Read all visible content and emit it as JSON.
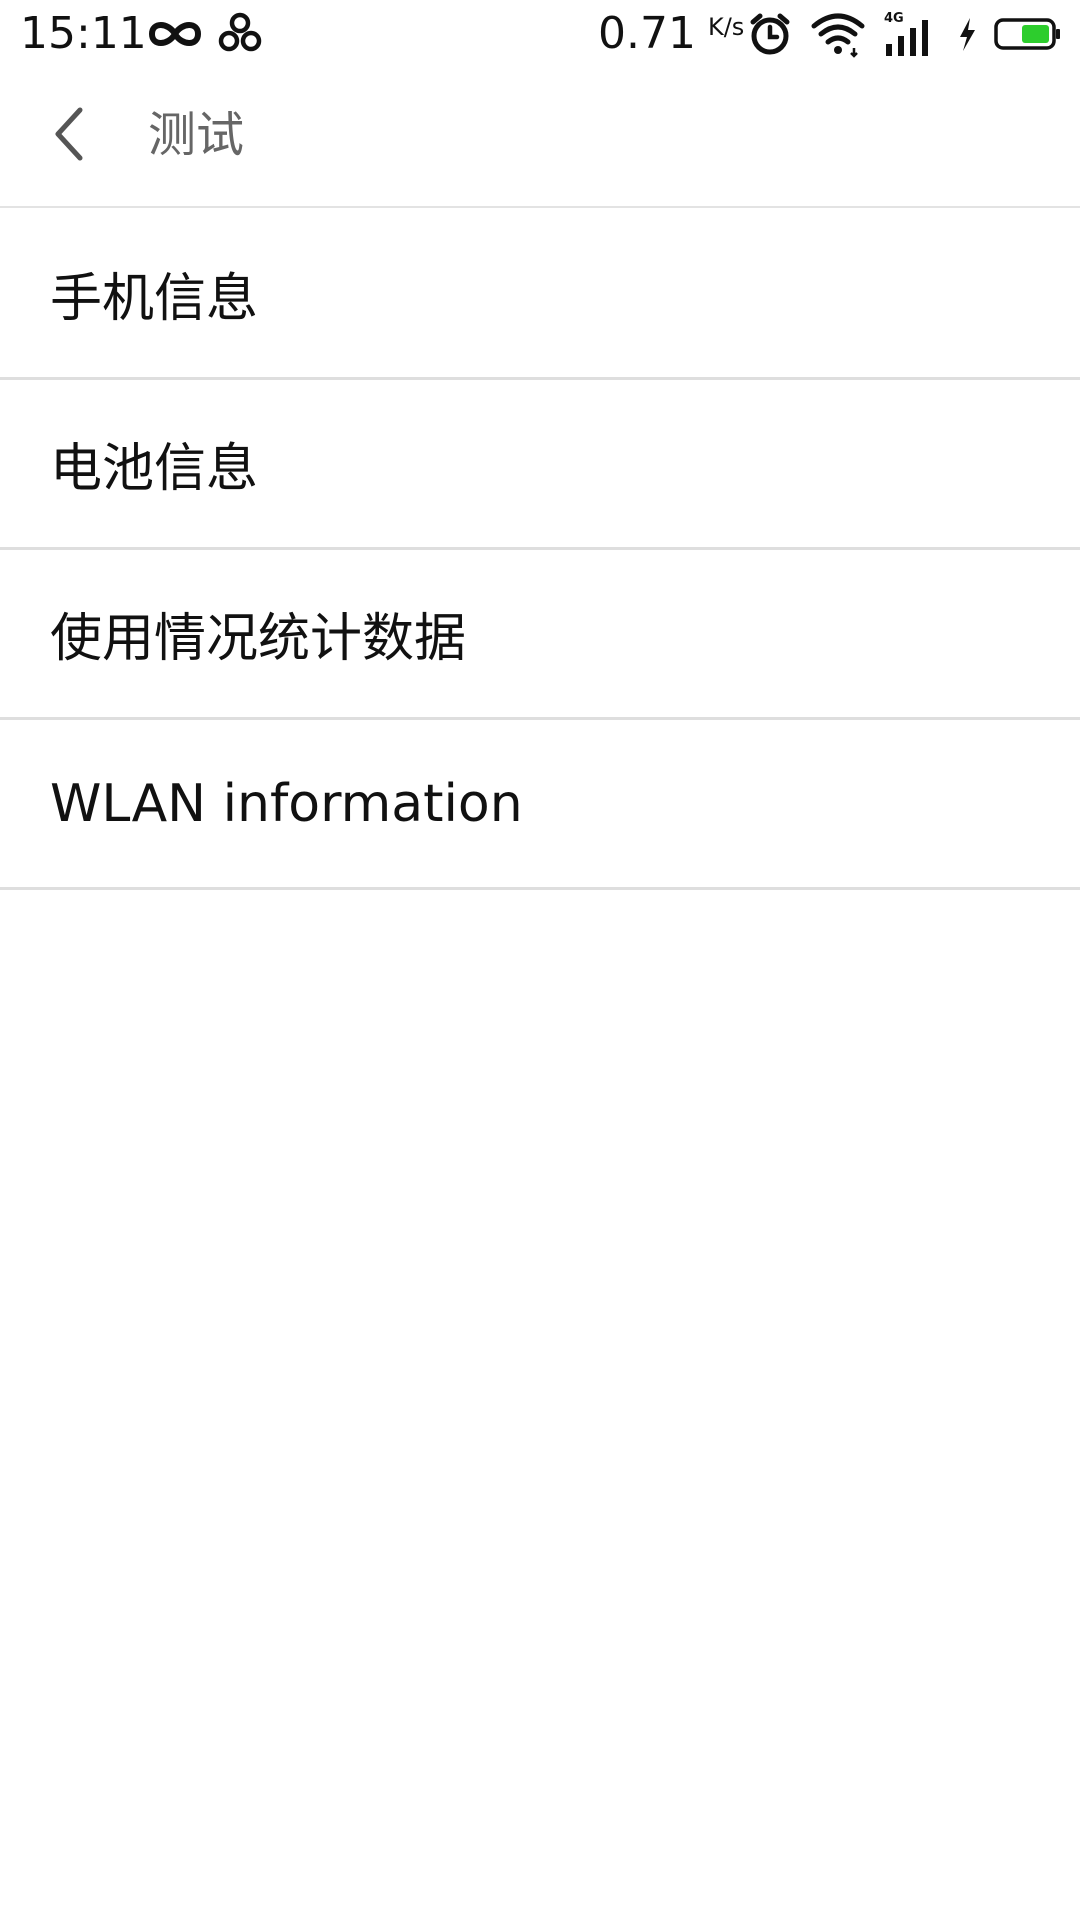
{
  "status_bar": {
    "time": "15:11",
    "net_speed_value": "0.71",
    "net_speed_unit": "K/s",
    "icons": [
      "infinity-icon",
      "pinwheel-icon",
      "alarm-icon",
      "wifi-icon",
      "signal-4g-icon",
      "charging-bolt-icon",
      "battery-icon"
    ],
    "network_type": "4G",
    "battery_color": "#2dcd2d"
  },
  "toolbar": {
    "title": "测试",
    "back_icon": "chevron-left-icon"
  },
  "menu": {
    "items": [
      {
        "label": "手机信息"
      },
      {
        "label": "电池信息"
      },
      {
        "label": "使用情况统计数据"
      },
      {
        "label": "WLAN information"
      }
    ]
  }
}
